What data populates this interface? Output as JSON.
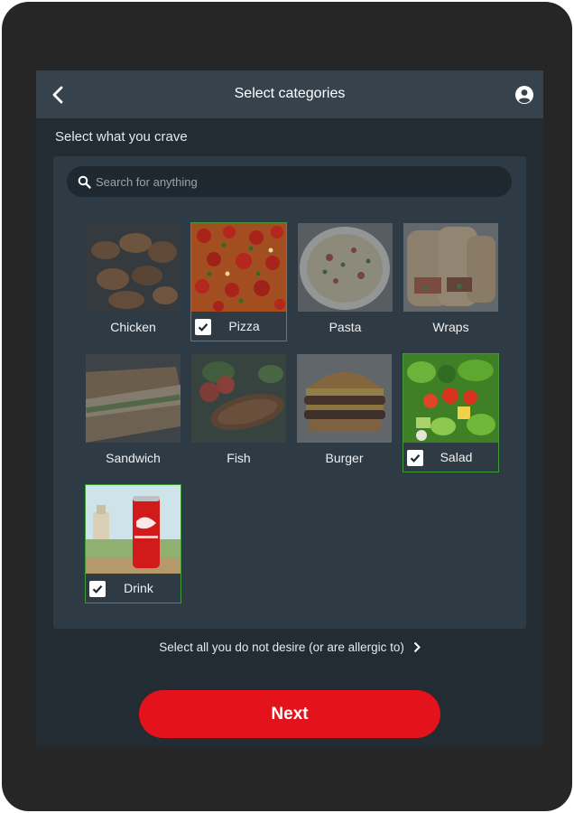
{
  "header": {
    "title": "Select categories",
    "back_icon": "chevron-left-icon",
    "account_icon": "account-circle-icon"
  },
  "subtitle": "Select what you crave",
  "search": {
    "placeholder": "Search for anything",
    "icon": "search-icon"
  },
  "categories": [
    {
      "label": "Chicken",
      "selected": false
    },
    {
      "label": "Pizza",
      "selected": true
    },
    {
      "label": "Pasta",
      "selected": false
    },
    {
      "label": "Wraps",
      "selected": false
    },
    {
      "label": "Sandwich",
      "selected": false
    },
    {
      "label": "Fish",
      "selected": false
    },
    {
      "label": "Burger",
      "selected": false
    },
    {
      "label": "Salad",
      "selected": true
    },
    {
      "label": "Drink",
      "selected": true
    }
  ],
  "exclude_link": "Select all you do not desire (or are allergic to)",
  "next_button": "Next",
  "colors": {
    "accent": "#e3121b",
    "selected_border": "#3f9b3a",
    "app_bar": "#36434d",
    "background": "#232c33"
  }
}
